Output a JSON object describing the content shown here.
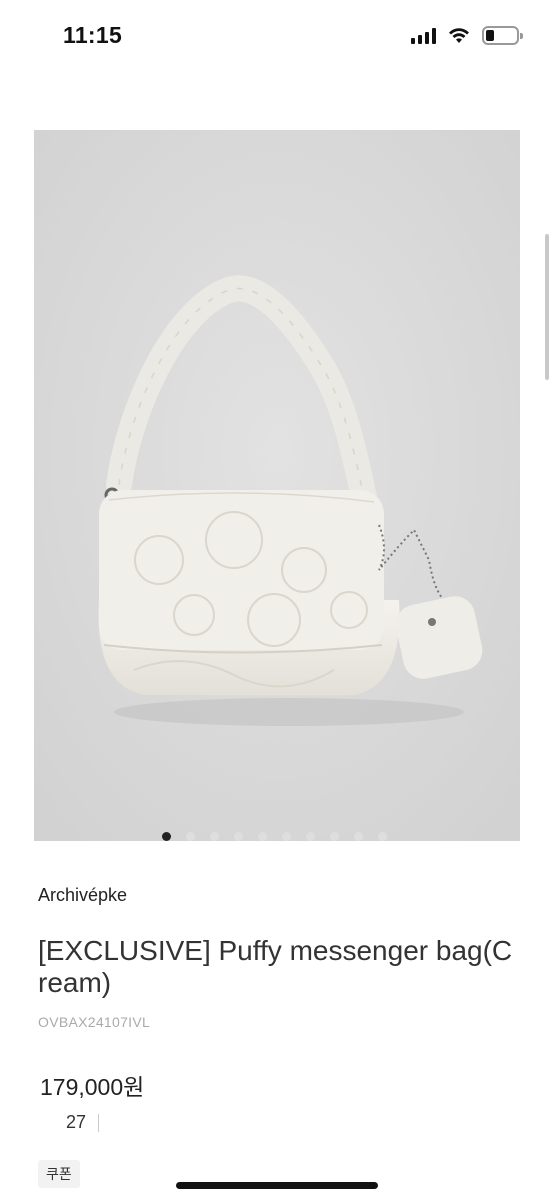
{
  "status_bar": {
    "time": "11:15"
  },
  "product": {
    "brand": "Archivépke",
    "name": "[EXCLUSIVE] Puffy messenger bag(Cream)",
    "code": "OVBAX24107IVL",
    "price": "179,000원",
    "likes": "27",
    "coupon_label": "쿠폰"
  },
  "carousel": {
    "total_images": 10,
    "active_index": 0
  },
  "colors": {
    "image_background": "#d9d9d9",
    "bag_color": "#eeece6",
    "dot_active": "#222222",
    "dot_inactive": "#dedede"
  }
}
